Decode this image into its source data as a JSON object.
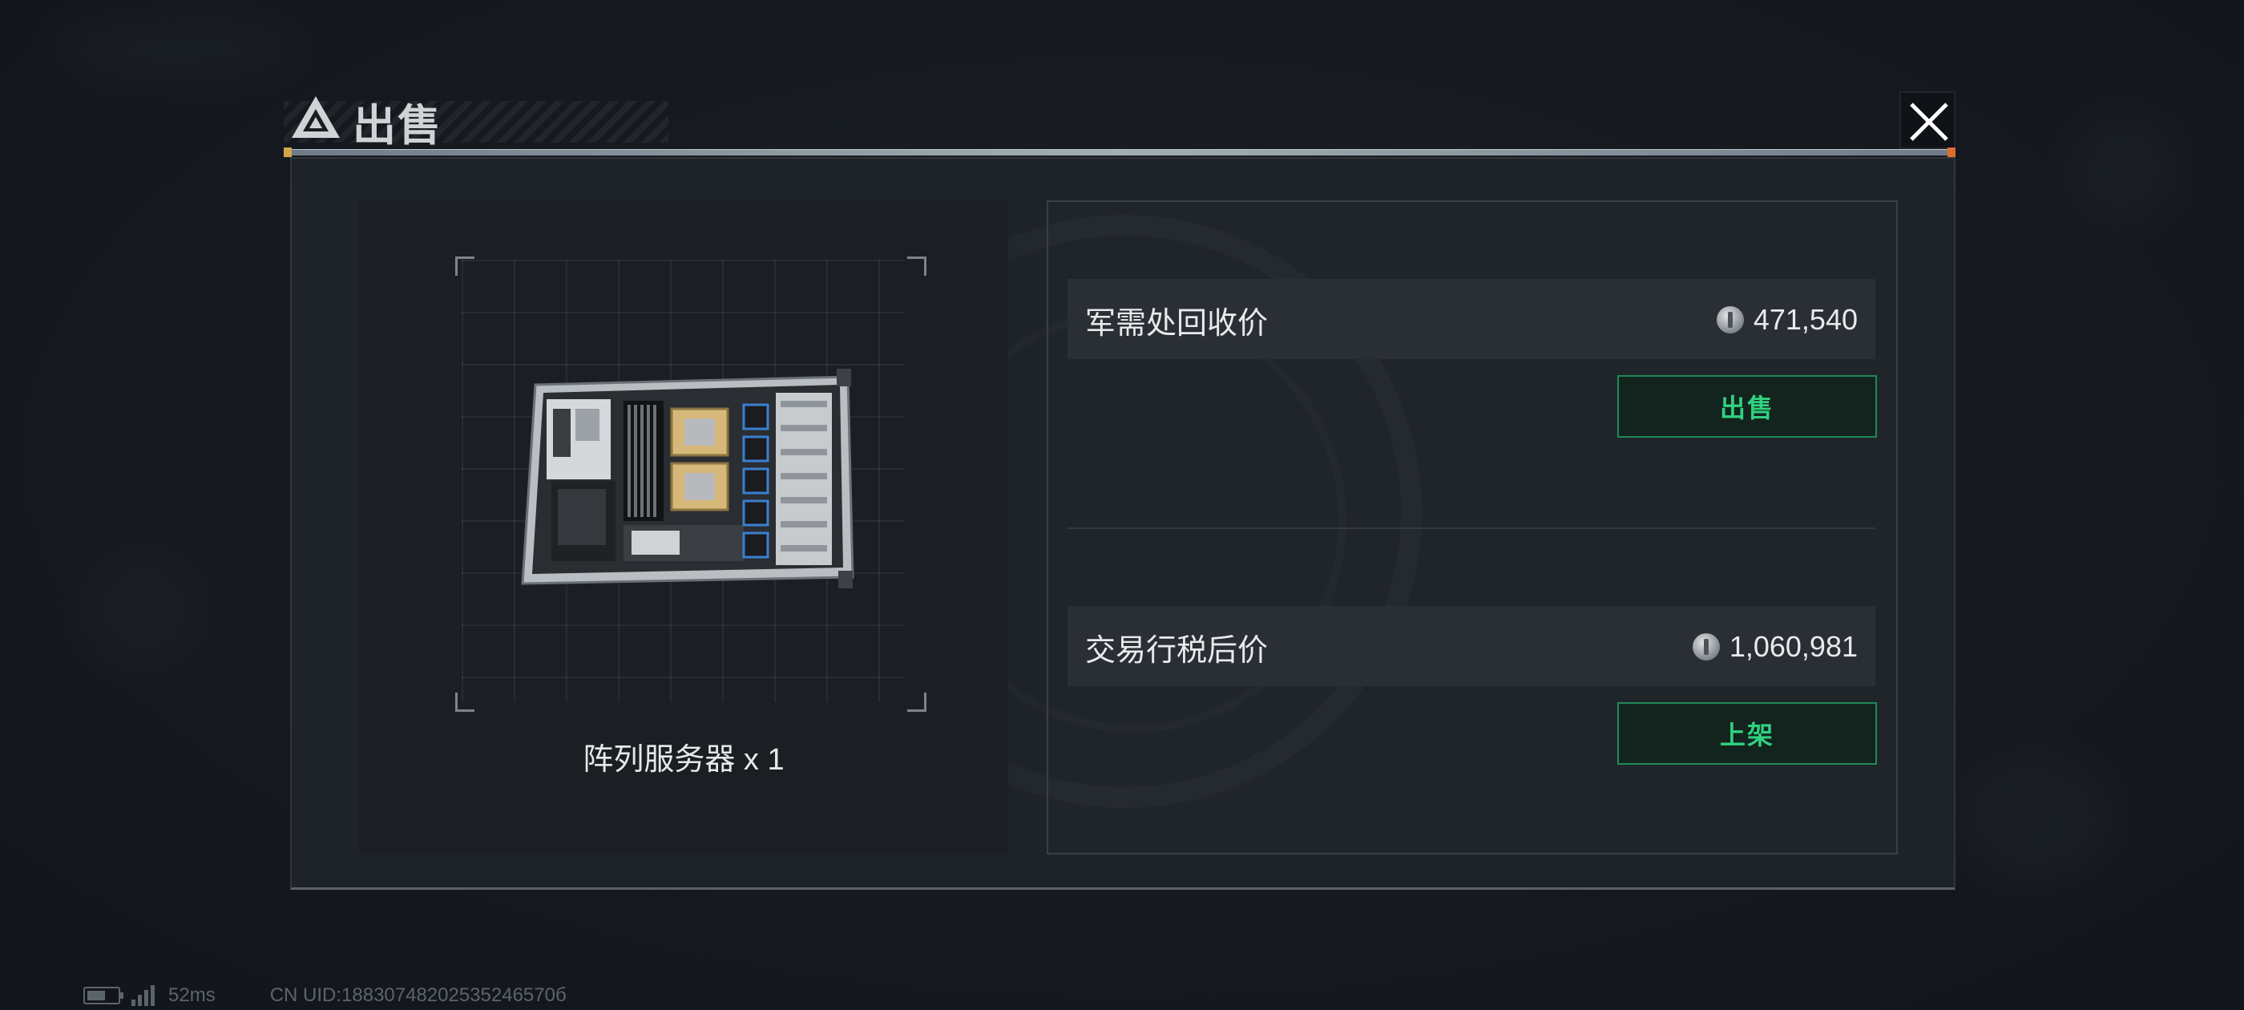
{
  "dialog": {
    "title": "出售",
    "title_icon": "triangle-logo-icon",
    "close_icon": "close-icon"
  },
  "item": {
    "image_icon": "array-server-image",
    "name": "阵列服务器 x 1"
  },
  "recycle": {
    "label": "军需处回收价",
    "currency_icon": "coin-icon",
    "value": "471,540",
    "button_label": "出售"
  },
  "trade": {
    "label": "交易行税后价",
    "currency_icon": "coin-icon",
    "value": "1,060,981",
    "button_label": "上架"
  },
  "status": {
    "ping": "52ms",
    "uid": "CN UID:18830748202535246570б"
  },
  "colors": {
    "accent_green": "#2fd27f",
    "button_border": "#1f8a57",
    "panel_bg": "#1e2328"
  }
}
